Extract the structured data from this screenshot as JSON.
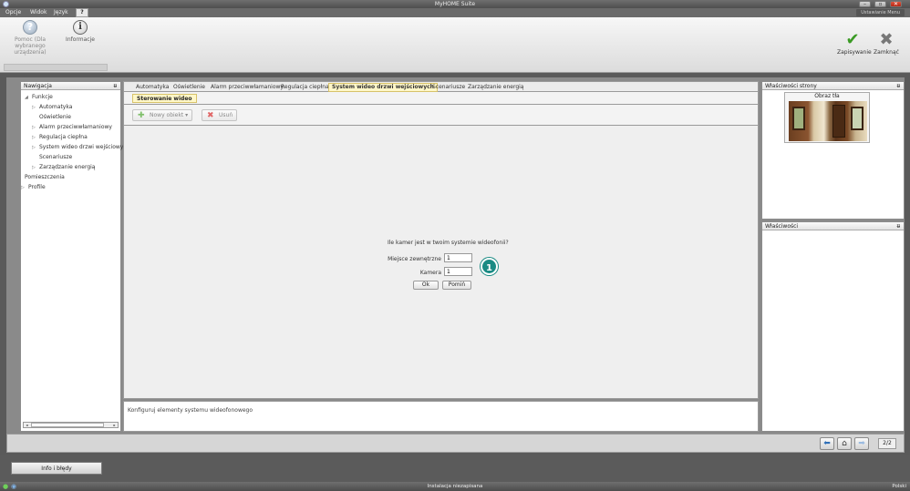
{
  "window": {
    "title": "MyHOME Suite"
  },
  "menubar": {
    "items": [
      {
        "label": "Opcje"
      },
      {
        "label": "Widok"
      },
      {
        "label": "Język"
      },
      {
        "label": "?"
      }
    ],
    "right_tag": "Ustawianie Menu"
  },
  "toolbar": {
    "help_label": "Pomoc (Dla wybranego urządzenia)",
    "info_label": "Informacje",
    "save_label": "Zapisywanie",
    "close_label": "Zamknąć"
  },
  "navigation": {
    "header": "Nawigacja",
    "tree": [
      {
        "label": "Funkcje",
        "depth": 0,
        "expanded": true,
        "arrow": true
      },
      {
        "label": "Automatyka",
        "depth": 1,
        "arrow": true
      },
      {
        "label": "Oświetlenie",
        "depth": 1,
        "arrow": false
      },
      {
        "label": "Alarm przeciwwłamaniowy",
        "depth": 1,
        "arrow": true
      },
      {
        "label": "Regulacja ciepłna",
        "depth": 1,
        "arrow": true
      },
      {
        "label": "System wideo drzwi wejściowy",
        "depth": 1,
        "arrow": true
      },
      {
        "label": "Scenariusze",
        "depth": 1,
        "arrow": false
      },
      {
        "label": "Zarządzanie energią",
        "depth": 1,
        "arrow": true
      },
      {
        "label": "Pomieszczenia",
        "depth": 0,
        "arrow": false
      },
      {
        "label": "Profile",
        "depth": 0,
        "arrow": true
      }
    ]
  },
  "tabs": [
    {
      "label": "Automatyka",
      "active": false
    },
    {
      "label": "Oświetlenie",
      "active": false
    },
    {
      "label": "Alarm przeciwwłamaniowy",
      "active": false
    },
    {
      "label": "Regulacja ciepłna",
      "active": false
    },
    {
      "label": "System wideo drzwi wejściowych",
      "active": true
    },
    {
      "label": "Scenariusze",
      "active": false
    },
    {
      "label": "Zarządzanie energią",
      "active": false
    }
  ],
  "subtab": {
    "label": "Sterowanie wideo"
  },
  "actions": {
    "new_object": "Nowy obiekt",
    "delete": "Usuń"
  },
  "dialog": {
    "question": "Ile kamer jest w twoim systemie wideofonii?",
    "outdoor_label": "Miejsce zewnętrzne",
    "outdoor_value": "1",
    "camera_label": "Kamera",
    "camera_value": "1",
    "ok_label": "Ok",
    "cancel_label": "Pomiń"
  },
  "callout": {
    "number": "1"
  },
  "description": "Konfiguruj elementy systemu wideofonowego",
  "page_properties": {
    "header": "Właściwości strony",
    "bg_label": "Obraz tła"
  },
  "properties": {
    "header": "Właściwości"
  },
  "footer_nav": {
    "page": "2/2"
  },
  "bottom": {
    "info_tab": "Info i błędy"
  },
  "status": {
    "center": "Instalacja niezapisana",
    "language": "Polski"
  }
}
